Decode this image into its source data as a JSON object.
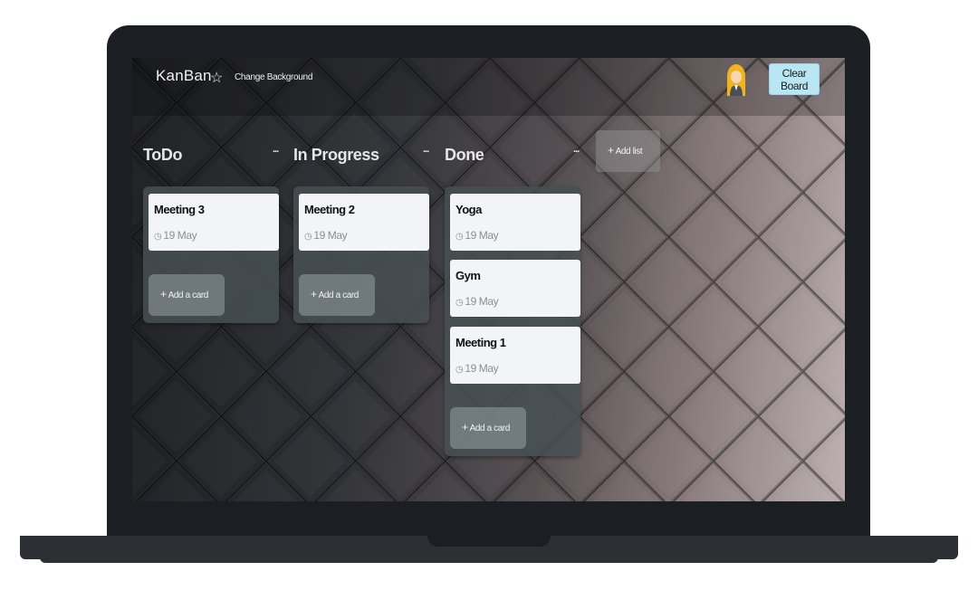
{
  "app": {
    "title": "KanBan",
    "star_icon": "star-outline-icon",
    "change_background_label": "Change Background",
    "avatar_icon": "user-avatar-icon",
    "clear_board_label": "Clear Board",
    "colors": {
      "clear_button": "#b8e6f3",
      "card": "#f3f4f6",
      "list": "#465054"
    }
  },
  "board": {
    "add_list_label": "Add list",
    "lists": [
      {
        "title": "ToDo",
        "menu_label": "...",
        "cards": [
          {
            "title": "Meeting 3",
            "date": "19 May"
          }
        ],
        "add_card_label": "Add a card"
      },
      {
        "title": "In Progress",
        "menu_label": "...",
        "cards": [
          {
            "title": "Meeting 2",
            "date": "19 May"
          }
        ],
        "add_card_label": "Add a card"
      },
      {
        "title": "Done",
        "menu_label": "...",
        "cards": [
          {
            "title": "Yoga",
            "date": "19 May"
          },
          {
            "title": "Gym",
            "date": "19 May"
          },
          {
            "title": "Meeting 1",
            "date": "19 May"
          }
        ],
        "add_card_label": "Add a card"
      }
    ]
  }
}
